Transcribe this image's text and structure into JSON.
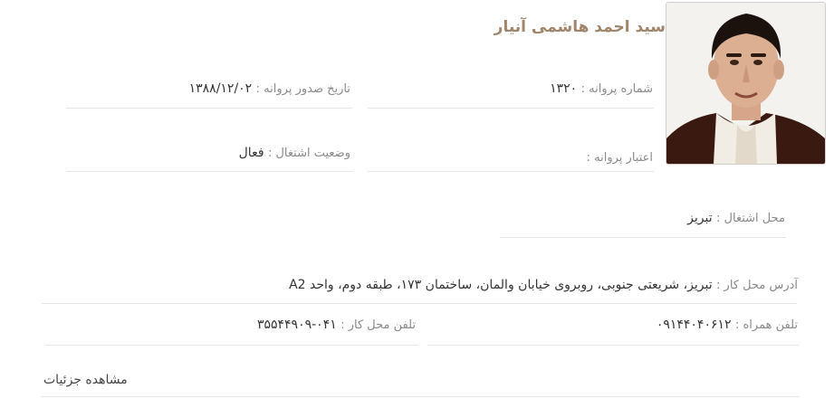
{
  "profile": {
    "name": "سید احمد هاشمی آنیار",
    "license_number": {
      "label": "شماره پروانه :",
      "value": "۱۳۲۰"
    },
    "issue_date": {
      "label": "تاریخ صدور پروانه :",
      "value": "۱۳۸۸/۱۲/۰۲"
    },
    "license_validity": {
      "label": "اعتبار پروانه :",
      "value": ""
    },
    "employment_status": {
      "label": "وضعیت اشتغال :",
      "value": "فعال"
    },
    "work_place": {
      "label": "محل اشتغال :",
      "value": "تبریز"
    },
    "work_address": {
      "label": "آدرس محل کار :",
      "value": "تبریز، شریعتی جنوبی، روبروی خیابان والمان، ساختمان ۱۷۳، طبقه دوم، واحد A2"
    },
    "mobile": {
      "label": "تلفن همراه :",
      "value": "۰۹۱۴۴۰۴۰۶۱۲"
    },
    "work_phone": {
      "label": "تلفن محل کار :",
      "value": "۰۴۱-۳۵۵۴۴۹۰۹"
    },
    "details_link": "مشاهده جزئیات"
  },
  "colors": {
    "name": "#a0856a",
    "label": "#8a8a8a",
    "divider": "#e6e6e6"
  }
}
